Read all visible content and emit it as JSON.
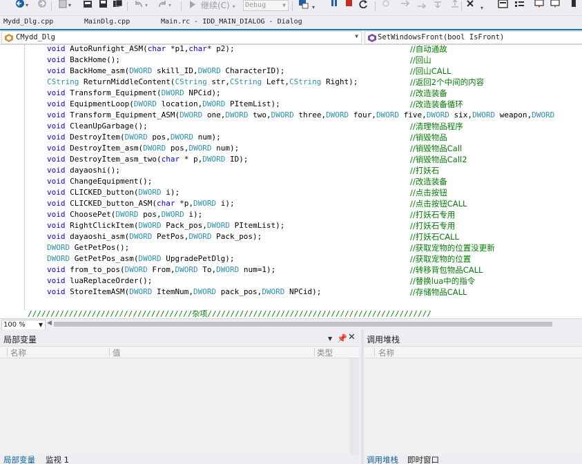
{
  "toolbar": {
    "continue_label": "继续(C)",
    "continue_arrow": "▾",
    "config_value": "Debug",
    "icons": [
      "back-icon",
      "forward-icon",
      "new-project-icon",
      "open-file-icon",
      "save-icon",
      "save-all-icon",
      "undo-icon",
      "redo-icon",
      "start-icon",
      "process-icon",
      "break-all-icon",
      "stop-icon",
      "restart-icon",
      "step-into-icon",
      "step-over-icon",
      "step-out-icon",
      "comment-icon",
      "bookmark-icon",
      "find-icon"
    ]
  },
  "file_tabs": [
    "Mydd_Dlg.cpp",
    "MainDlg.cpp",
    "Main.rc - IDD_MAIN_DIALOG - Dialog"
  ],
  "navbar": {
    "class_scope": "CMydd_Dlg",
    "member_scope": "SetWindowsFront(bool IsFront)"
  },
  "code_lines": [
    {
      "code": [
        [
          "kw",
          "void"
        ],
        [
          "txt",
          " AutoRunfight_ASM("
        ],
        [
          "kw",
          "char"
        ],
        [
          "txt",
          " *p1,"
        ],
        [
          "kw",
          "char"
        ],
        [
          "txt",
          "* p2);"
        ]
      ],
      "comment": "//自动通故"
    },
    {
      "code": [
        [
          "kw",
          "void"
        ],
        [
          "txt",
          " BackHome();"
        ]
      ],
      "comment": "//回山"
    },
    {
      "code": [
        [
          "kw",
          "void"
        ],
        [
          "txt",
          " BackHome_asm("
        ],
        [
          "type",
          "DWORD"
        ],
        [
          "txt",
          " skill_ID,"
        ],
        [
          "type",
          "DWORD"
        ],
        [
          "txt",
          " CharacterID);"
        ]
      ],
      "comment": "//回山CALL"
    },
    {
      "code": [
        [
          "type",
          "CString"
        ],
        [
          "txt",
          " ReturnMiddleContent("
        ],
        [
          "type",
          "CString"
        ],
        [
          "txt",
          " str,"
        ],
        [
          "type",
          "CString"
        ],
        [
          "txt",
          " Left,"
        ],
        [
          "type",
          "CString"
        ],
        [
          "txt",
          " Right);"
        ]
      ],
      "comment": "//返回2个中间的内容"
    },
    {
      "code": [
        [
          "kw",
          "void"
        ],
        [
          "txt",
          " Transform_Equipment("
        ],
        [
          "type",
          "DWORD"
        ],
        [
          "txt",
          " NPCid);"
        ]
      ],
      "comment": "//改造装备"
    },
    {
      "code": [
        [
          "kw",
          "void"
        ],
        [
          "txt",
          " EquipmentLoop("
        ],
        [
          "type",
          "DWORD"
        ],
        [
          "txt",
          " location,"
        ],
        [
          "type",
          "DWORD"
        ],
        [
          "txt",
          " PItemList);"
        ]
      ],
      "comment": "//改造装备循环"
    },
    {
      "code": [
        [
          "kw",
          "void"
        ],
        [
          "txt",
          " Transform_Equipment_ASM("
        ],
        [
          "type",
          "DWORD"
        ],
        [
          "txt",
          " one,"
        ],
        [
          "type",
          "DWORD"
        ],
        [
          "txt",
          " two,"
        ],
        [
          "type",
          "DWORD"
        ],
        [
          "txt",
          " three,"
        ],
        [
          "type",
          "DWORD"
        ],
        [
          "txt",
          " four,"
        ],
        [
          "type",
          "DWORD"
        ],
        [
          "txt",
          " five,"
        ],
        [
          "type",
          "DWORD"
        ],
        [
          "txt",
          " six,"
        ],
        [
          "type",
          "DWORD"
        ],
        [
          "txt",
          " weapon,"
        ],
        [
          "type",
          "DWORD"
        ]
      ],
      "comment": ""
    },
    {
      "code": [
        [
          "kw",
          "void"
        ],
        [
          "txt",
          " CleanUpGarbage();"
        ]
      ],
      "comment": "//清理物品程序"
    },
    {
      "code": [
        [
          "kw",
          "void"
        ],
        [
          "txt",
          " DestroyItem("
        ],
        [
          "type",
          "DWORD"
        ],
        [
          "txt",
          " pos,"
        ],
        [
          "type",
          "DWORD"
        ],
        [
          "txt",
          " num);"
        ]
      ],
      "comment": "//销毁物品"
    },
    {
      "code": [
        [
          "kw",
          "void"
        ],
        [
          "txt",
          " DestroyItem_asm("
        ],
        [
          "type",
          "DWORD"
        ],
        [
          "txt",
          " pos,"
        ],
        [
          "type",
          "DWORD"
        ],
        [
          "txt",
          " num);"
        ]
      ],
      "comment": "//销毁物品Call"
    },
    {
      "code": [
        [
          "kw",
          "void"
        ],
        [
          "txt",
          " DestroyItem_asm_two("
        ],
        [
          "kw",
          "char"
        ],
        [
          "txt",
          " * p,"
        ],
        [
          "type",
          "DWORD"
        ],
        [
          "txt",
          " ID);"
        ]
      ],
      "comment": "//销毁物品Call2"
    },
    {
      "code": [
        [
          "kw",
          "void"
        ],
        [
          "txt",
          " dayaoshi();"
        ]
      ],
      "comment": "//打妖石"
    },
    {
      "code": [
        [
          "kw",
          "void"
        ],
        [
          "txt",
          " ChangeEquipment();"
        ]
      ],
      "comment": "//改造装备"
    },
    {
      "code": [
        [
          "kw",
          "void"
        ],
        [
          "txt",
          " CLICKED_button("
        ],
        [
          "type",
          "DWORD"
        ],
        [
          "txt",
          " i);"
        ]
      ],
      "comment": "//点击按钮"
    },
    {
      "code": [
        [
          "kw",
          "void"
        ],
        [
          "txt",
          " CLICKED_button_ASM("
        ],
        [
          "kw",
          "char"
        ],
        [
          "txt",
          " *p,"
        ],
        [
          "type",
          "DWORD"
        ],
        [
          "txt",
          " i);"
        ]
      ],
      "comment": "//点击按钮CALL"
    },
    {
      "code": [
        [
          "kw",
          "void"
        ],
        [
          "txt",
          " ChoosePet("
        ],
        [
          "type",
          "DWORD"
        ],
        [
          "txt",
          " pos,"
        ],
        [
          "type",
          "DWORD"
        ],
        [
          "txt",
          " i);"
        ]
      ],
      "comment": "//打妖石专用"
    },
    {
      "code": [
        [
          "kw",
          "void"
        ],
        [
          "txt",
          " RightClickItem("
        ],
        [
          "type",
          "DWORD"
        ],
        [
          "txt",
          " Pack_pos,"
        ],
        [
          "type",
          "DWORD"
        ],
        [
          "txt",
          " PItemList);"
        ]
      ],
      "comment": "//打妖石专用"
    },
    {
      "code": [
        [
          "kw",
          "void"
        ],
        [
          "txt",
          " dayaoshi_asm("
        ],
        [
          "type",
          "DWORD"
        ],
        [
          "txt",
          " PetPos,"
        ],
        [
          "type",
          "DWORD"
        ],
        [
          "txt",
          " Pack_pos);"
        ]
      ],
      "comment": "//打妖石CALL"
    },
    {
      "code": [
        [
          "type",
          "DWORD"
        ],
        [
          "txt",
          " GetPetPos();"
        ]
      ],
      "comment": "//获取宠物的位置没更新"
    },
    {
      "code": [
        [
          "type",
          "DWORD"
        ],
        [
          "txt",
          " GetPetPos_asm("
        ],
        [
          "type",
          "DWORD"
        ],
        [
          "txt",
          " UpgradePetDlg);"
        ]
      ],
      "comment": "//获取宠物的位置"
    },
    {
      "code": [
        [
          "kw",
          "void"
        ],
        [
          "txt",
          " from_to_pos("
        ],
        [
          "type",
          "DWORD"
        ],
        [
          "txt",
          " From,"
        ],
        [
          "type",
          "DWORD"
        ],
        [
          "txt",
          " To,"
        ],
        [
          "type",
          "DWORD"
        ],
        [
          "txt",
          " num=1);"
        ]
      ],
      "comment": "//转移背包物品CALL"
    },
    {
      "code": [
        [
          "kw",
          "void"
        ],
        [
          "txt",
          " luaReplaceOrder();"
        ]
      ],
      "comment": "//替换lua中的指令"
    },
    {
      "code": [
        [
          "kw",
          "void"
        ],
        [
          "txt",
          " StoreItemASM("
        ],
        [
          "type",
          "DWORD"
        ],
        [
          "txt",
          " ItemNum,"
        ],
        [
          "type",
          "DWORD"
        ],
        [
          "txt",
          " pack_pos,"
        ],
        [
          "type",
          "DWORD"
        ],
        [
          "txt",
          " NPCid);"
        ]
      ],
      "comment": "//存储物品CALL"
    },
    {
      "code": [],
      "comment": ""
    },
    {
      "code": [
        [
          "cmt",
          "////////////////////////////////////杂项/////////////////////////////////////////////////"
        ]
      ],
      "comment": ""
    }
  ],
  "zoom": "100 %",
  "locals_panel": {
    "title": "局部变量",
    "columns": [
      "名称",
      "值",
      "类型"
    ],
    "tabs": [
      "局部变量",
      "监视 1"
    ]
  },
  "callstack_panel": {
    "title": "调用堆栈",
    "columns": [
      "名称"
    ],
    "tabs": [
      "调用堆栈",
      "即时窗口"
    ]
  }
}
